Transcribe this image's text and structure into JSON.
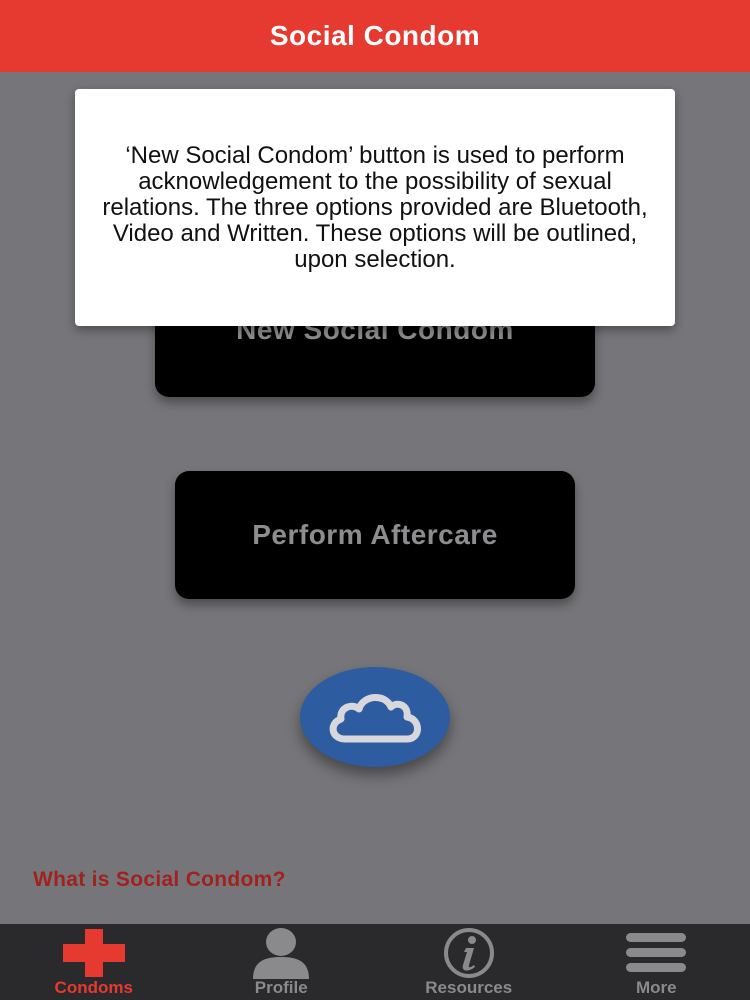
{
  "header": {
    "title": "Social Condom"
  },
  "main": {
    "new_button_label": "New Social Condom",
    "aftercare_button_label": "Perform Aftercare",
    "cloud_icon": "cloud-icon",
    "what_is_link": "What is Social Condom?"
  },
  "tooltip": {
    "text": "‘New Social Condom’ button is used to perform acknowledgement to the possibility of sexual relations. The three options provided are Bluetooth, Video and Written. These options will be outlined, upon selection."
  },
  "tabs": [
    {
      "label": "Condoms",
      "icon": "red-cross-icon",
      "active": true
    },
    {
      "label": "Profile",
      "icon": "person-icon",
      "active": false
    },
    {
      "label": "Resources",
      "icon": "info-icon",
      "active": false
    },
    {
      "label": "More",
      "icon": "menu-icon",
      "active": false
    }
  ],
  "colors": {
    "accent": "#e63a30",
    "overlay_bg": "#76767a",
    "link": "#a0221f",
    "cloud_button": "#2e5ca0",
    "tabbar": "#2a2a2c"
  }
}
